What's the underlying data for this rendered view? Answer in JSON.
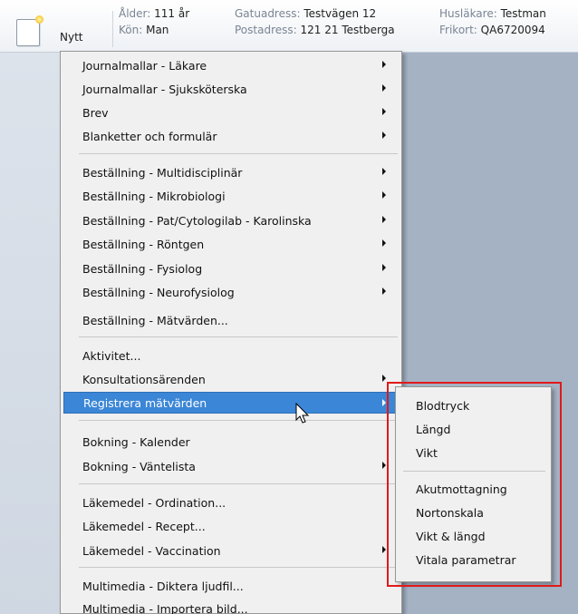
{
  "header": {
    "new_button": "Nytt",
    "fields": [
      {
        "key": "Ålder:",
        "value": "111 år"
      },
      {
        "key": "Kön:",
        "value": "Man"
      },
      {
        "key": "Gatuadress:",
        "value": "Testvägen 12"
      },
      {
        "key": "Postadress:",
        "value": "121 21 Testberga"
      },
      {
        "key": "Husläkare:",
        "value": "Testman"
      },
      {
        "key": "Frikort:",
        "value": "QA6720094"
      }
    ]
  },
  "menu": {
    "items": [
      {
        "label": "Journalmallar - Läkare",
        "submenu": true
      },
      {
        "label": "Journalmallar - Sjuksköterska",
        "submenu": true
      },
      {
        "label": "Brev",
        "submenu": true
      },
      {
        "label": "Blanketter och formulär",
        "submenu": true
      },
      {
        "label": "Beställning - Multidisciplinär",
        "submenu": true
      },
      {
        "label": "Beställning - Mikrobiologi",
        "submenu": true
      },
      {
        "label": "Beställning - Pat/Cytologilab - Karolinska",
        "submenu": true
      },
      {
        "label": "Beställning - Röntgen",
        "submenu": true
      },
      {
        "label": "Beställning - Fysiolog",
        "submenu": true
      },
      {
        "label": "Beställning - Neurofysiolog",
        "submenu": true
      },
      {
        "label": "Beställning - Mätvärden...",
        "submenu": false
      },
      {
        "label": "Aktivitet...",
        "submenu": false
      },
      {
        "label": "Konsultationsärenden",
        "submenu": true
      },
      {
        "label": "Registrera mätvärden",
        "submenu": true,
        "highlighted": true
      },
      {
        "label": "Bokning - Kalender",
        "submenu": false
      },
      {
        "label": "Bokning - Väntelista",
        "submenu": true
      },
      {
        "label": "Läkemedel - Ordination...",
        "submenu": false
      },
      {
        "label": "Läkemedel - Recept...",
        "submenu": false
      },
      {
        "label": "Läkemedel - Vaccination",
        "submenu": true
      },
      {
        "label": "Multimedia - Diktera ljudfil...",
        "submenu": false
      },
      {
        "label": "Multimedia - Importera bild...",
        "submenu": false
      }
    ]
  },
  "submenu": {
    "items": [
      {
        "label": "Blodtryck"
      },
      {
        "label": "Längd"
      },
      {
        "label": "Vikt"
      },
      {
        "label": "Akutmottagning"
      },
      {
        "label": "Nortonskala"
      },
      {
        "label": "Vikt & längd"
      },
      {
        "label": "Vitala parametrar"
      }
    ]
  },
  "colors": {
    "highlight": "#3b86d6",
    "annotation_box": "#e01a1a"
  }
}
